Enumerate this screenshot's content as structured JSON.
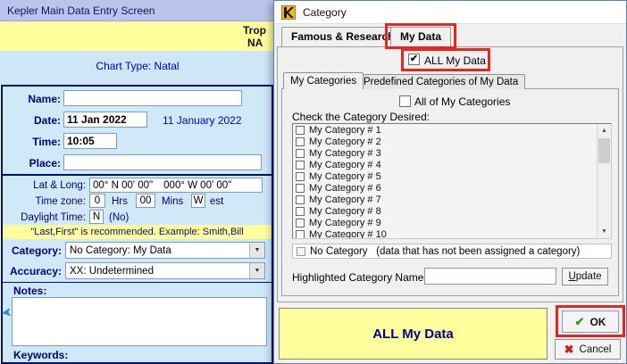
{
  "main_window": {
    "title": "Kepler Main Data Entry Screen",
    "banner": {
      "line1": "Trop",
      "line2": "NA"
    },
    "chart_type": "Chart Type: Natal",
    "form": {
      "name_label": "Name:",
      "name_value": "",
      "date_label": "Date:",
      "date_value": "11 Jan 2022",
      "date_long": "11 January 2022",
      "time_label": "Time:",
      "time_value": "10:05",
      "place_label": "Place:",
      "place_value": "",
      "latlong_label": "Lat & Long:",
      "lat_value": "00° N 00' 00\"",
      "long_value": "000° W 00' 00\"",
      "timezone_label": "Time zone:",
      "tz_hours": "0",
      "tz_hours_unit": "Hrs",
      "tz_mins": "00",
      "tz_mins_unit": "Mins",
      "tz_dir": "W",
      "tz_dir_suffix": "est",
      "daylight_label": "Daylight Time:",
      "daylight_value": "N",
      "daylight_suffix": "(No)",
      "name_hint": "\"Last,First\" is recommended.  Example: Smith,Bill",
      "category_label": "Category:",
      "category_value": "No Category: My Data",
      "accuracy_label": "Accuracy:",
      "accuracy_value": "XX:  Undetermined",
      "notes_label": "Notes:",
      "notes_value": "",
      "keywords_label": "Keywords:"
    }
  },
  "dialog": {
    "title": "Category",
    "tab_famous": "Famous & Research",
    "tab_mydata": "My Data",
    "all_my_data_checkbox": "ALL My Data",
    "inner_tab_my_categories": "My Categories",
    "inner_tab_predefined": "Predefined Categories of My Data",
    "all_of_my_categories": "All of My Categories",
    "list_label": "Check the Category Desired:",
    "categories": [
      "My Category # 1",
      "My Category # 2",
      "My Category # 3",
      "My Category # 4",
      "My Category # 5",
      "My Category # 6",
      "My Category # 7",
      "My Category # 8",
      "My Category # 9",
      "My Category # 10"
    ],
    "no_category_label": "No Category   (data that has not been assigned a category)",
    "highlighted_label": "Highlighted Category Name:",
    "highlighted_value": "",
    "update_button": "Update",
    "all_my_data_button": "ALL My Data",
    "ok_button": "OK",
    "cancel_button": "Cancel"
  },
  "icons": {
    "dropdown": "▼",
    "scroll_up": "▲",
    "scroll_down": "▼",
    "check": "✔",
    "ok_check": "✔",
    "cancel_x": "✖",
    "arrow": "➤"
  },
  "colors": {
    "annotation_red": "#e8261e",
    "titlebar": "#b9c5ea",
    "banner_yellow": "#ffff9e",
    "form_blue": "#cfe9f8",
    "navy": "#00107a",
    "ok_green": "#1ea31e",
    "cancel_red": "#c42222"
  }
}
